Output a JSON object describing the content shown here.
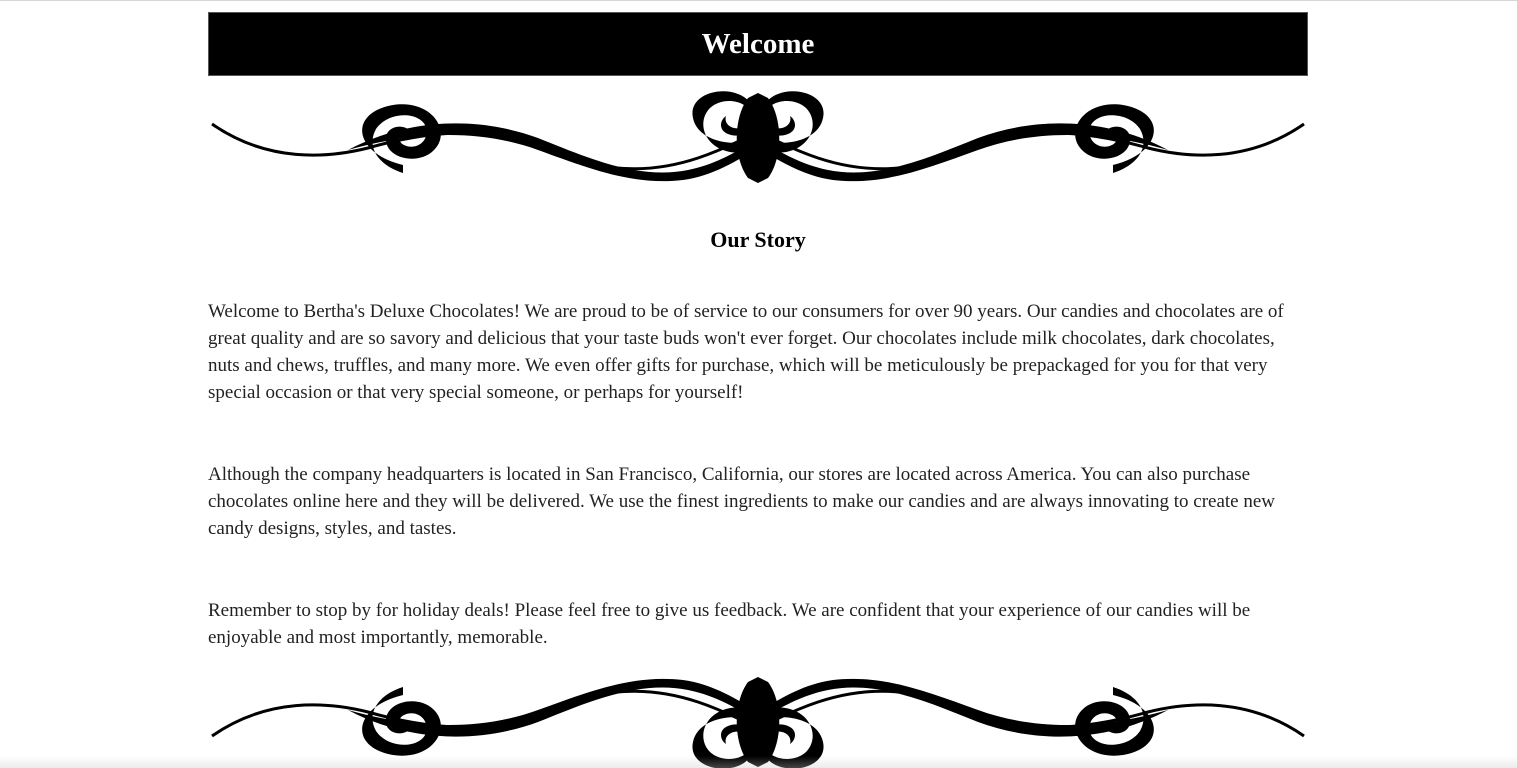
{
  "header": {
    "title": "Welcome"
  },
  "decorations": {
    "top_icon": "scroll-flourish-divider",
    "bottom_icon": "scroll-flourish-divider",
    "color": "#000000"
  },
  "story": {
    "heading": "Our Story",
    "paragraphs": [
      "Welcome to Bertha's Deluxe Chocolates! We are proud to be of service to our consumers for over 90 years. Our candies and chocolates are of great quality and are so savory and delicious that your taste buds won't ever forget. Our chocolates include milk chocolates, dark chocolates, nuts and chews, truffles, and many more. We even offer gifts for purchase, which will be meticulously be prepackaged for you for that very special occasion or that very special someone, or perhaps for yourself!",
      "Although the company headquarters is located in San Francisco, California, our stores are located across America. You can also purchase chocolates online here and they will be delivered. We use the finest ingredients to make our candies and are always innovating to create new candy designs, styles, and tastes.",
      "Remember to stop by for holiday deals! Please feel free to give us feedback. We are confident that your experience of our candies will be enjoyable and most importantly, memorable."
    ]
  }
}
